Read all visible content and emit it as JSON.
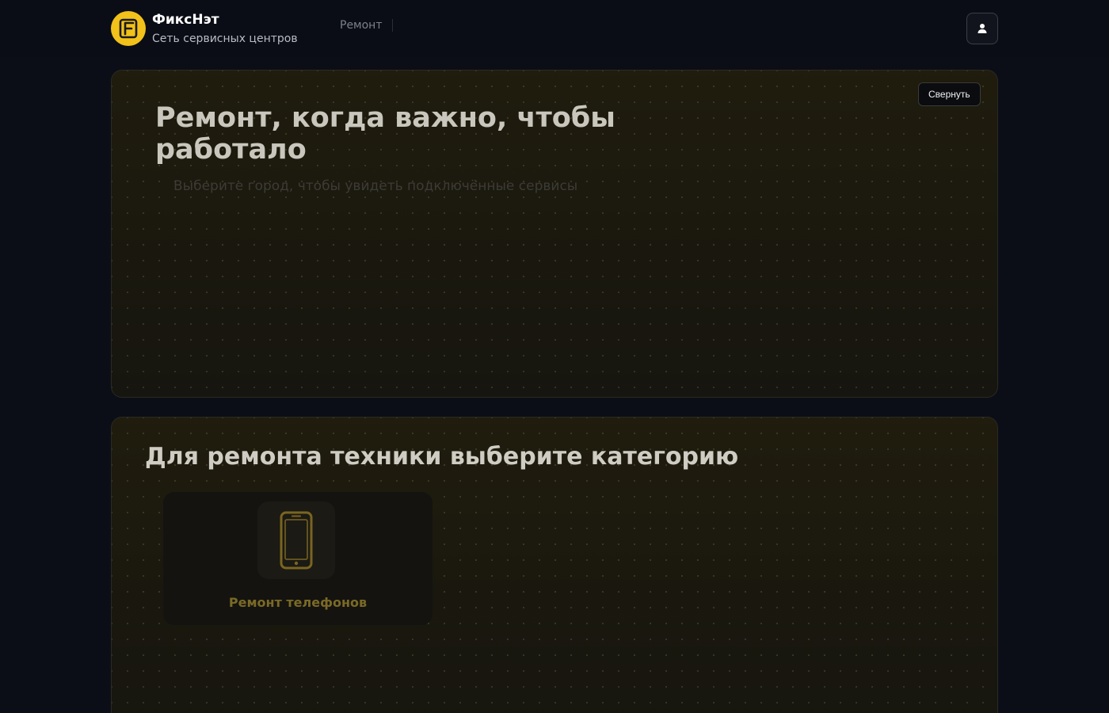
{
  "header": {
    "brand_name": "ФиксНэт",
    "brand_subtitle": "Сеть сервисных центров",
    "nav": [
      {
        "label": "Ремонт"
      }
    ],
    "logo_icon": "logo-icon",
    "profile_icon": "user-icon"
  },
  "hero": {
    "title": "Ремонт, когда важно, чтобы работало",
    "subtitle": "Выберите город, чтобы увидеть подключённые сервисы",
    "collapse_label": "Свернуть"
  },
  "categories": {
    "title": "Для ремонта техники выберите категорию",
    "items": [
      {
        "label": "Ремонт телефонов",
        "icon": "phone-icon"
      }
    ]
  },
  "colors": {
    "accent": "#f2c11a",
    "background": "#0b0e16"
  }
}
